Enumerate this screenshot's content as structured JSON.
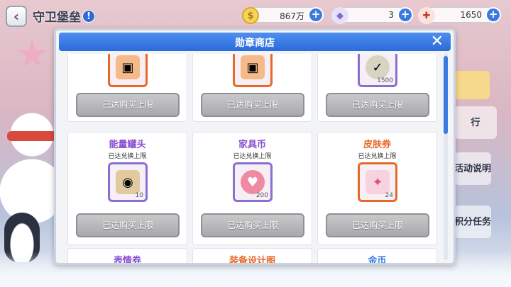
{
  "header": {
    "back_icon": "‹",
    "title": "守卫堡垒",
    "info_icon": "!"
  },
  "resources": [
    {
      "icon": "coin-icon",
      "glyph": "$",
      "value": "867万",
      "color": "#e6b830"
    },
    {
      "icon": "tag-icon",
      "glyph": "◆",
      "value": "3",
      "color": "#7a6fd0"
    },
    {
      "icon": "wrench-icon",
      "glyph": "✚",
      "value": "1650",
      "color": "#c0392b"
    }
  ],
  "side_buttons": [
    {
      "label": "行"
    },
    {
      "label": "活动说明"
    },
    {
      "label": "积分任务"
    }
  ],
  "shop": {
    "title": "勋章商店",
    "close": "✕",
    "buy_label": "已达购买上限",
    "items_top": [
      {
        "qty": "",
        "color": "#e8682a"
      },
      {
        "qty": "",
        "color": "#e8682a"
      },
      {
        "qty": "1500",
        "color": "#8a6fd0"
      }
    ],
    "items_middle": [
      {
        "name": "能量罐头",
        "name_color": "#8a4fd1",
        "sub": "已达兑换上限",
        "qty": "10",
        "color": "#8a6fd0"
      },
      {
        "name": "家具币",
        "name_color": "#8a4fd1",
        "sub": "已达兑换上限",
        "qty": "200",
        "color": "#8a6fd0"
      },
      {
        "name": "皮肤券",
        "name_color": "#e8682a",
        "sub": "已达兑换上限",
        "qty": "24",
        "color": "#e8682a"
      }
    ],
    "items_bottom": [
      {
        "name": "表情券",
        "name_color": "#8a4fd1"
      },
      {
        "name": "装备设计图",
        "name_color": "#e8682a"
      },
      {
        "name": "金币",
        "name_color": "#3a7be0"
      }
    ]
  }
}
